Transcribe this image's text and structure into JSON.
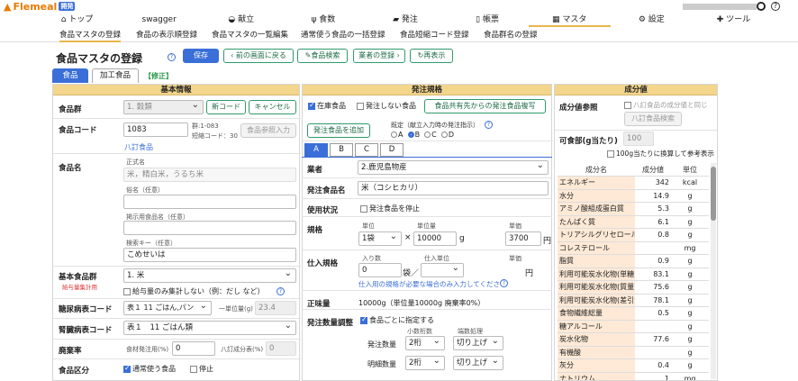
{
  "app": {
    "logo": "Flemeal",
    "badge": "開発"
  },
  "nav": [
    "トップ",
    "swagger",
    "献立",
    "食数",
    "発注",
    "帳票",
    "マスタ",
    "設定",
    "ツール"
  ],
  "nav_icons": [
    "home-icon",
    "",
    "rice-bowl-icon",
    "utensils-icon",
    "truck-icon",
    "document-icon",
    "table-icon",
    "gear-icon",
    "wrench-icon"
  ],
  "subnav": [
    "食品マスタの登録",
    "食品の表示順登録",
    "食品マスタの一覧編集",
    "通常使う食品の一括登録",
    "食品短縮コード登録",
    "食品群名の登録"
  ],
  "page": {
    "title": "食品マスタの登録",
    "help": "?"
  },
  "toolbar": {
    "save": "保存",
    "back": "前の画面に戻る",
    "search": "食品検索",
    "vendor": "業者の登録",
    "refresh": "再表示"
  },
  "tabs": {
    "food": "食品",
    "processed": "加工食品",
    "mode": "【修正】"
  },
  "basic": {
    "header": "基本情報",
    "group_label": "食品群",
    "group_value": "1. 穀類",
    "new_code": "新コード",
    "cancel": "キャンセル",
    "code_label": "食品コード",
    "code_value": "1083",
    "code_group": "群:1-083",
    "code_short": "短縮コード：30",
    "ref_input": "食品参照入力",
    "hattei": "八訂食品",
    "name_label": "食品名",
    "formal_label": "正式名",
    "formal_value": "米，精白米，うるち米",
    "common_label": "俗名（任意）",
    "common_value": "",
    "post_label": "掲示用食品名（任意）",
    "post_value": "",
    "search_label": "検索キー（任意）",
    "search_value": "こめせいは",
    "base_label": "基本食品群",
    "base_sub": "給与量集計用",
    "base_value": "1. 米",
    "base_check": "給与量のみ集計しない（例：だし など）",
    "diabetes_label": "糖尿病表コード",
    "diabetes_value": "表１ 11 ごはん,パン",
    "unit_label": "一単位量(g)",
    "unit_value": "23.4",
    "kidney_label": "腎臓病表コード",
    "kidney_value": "表１　11 ごはん類",
    "waste_label": "廃棄率",
    "waste_ratio_label": "食材発注用(%)",
    "waste_ratio_value": "0",
    "waste_h_label": "八訂成分表(%)",
    "waste_h_value": "0",
    "div_label": "食品区分",
    "div_normal": "通常使う食品",
    "div_stop": "停止"
  },
  "order": {
    "header": "発注規格",
    "stock": "在庫食品",
    "no_order": "発注しない食品",
    "copy": "食品共有先からの発注食品複写",
    "add": "発注食品を追加",
    "default_label": "既定（献立入力時の発注指示）",
    "options": [
      "A",
      "B",
      "C",
      "D"
    ],
    "selected": "B",
    "tabs": [
      "A",
      "B",
      "C",
      "D"
    ],
    "vendor_label": "業者",
    "vendor_value": "2.鹿児島物産",
    "name_label": "発注食品名",
    "name_value": "米（コシヒカリ）",
    "use_label": "使用状況",
    "use_check": "発注食品を停止",
    "spec_label": "規格",
    "unit_h": "単位",
    "unit_v": "1袋",
    "qty_h": "単位量",
    "qty_v": "10000",
    "qty_unit": "g",
    "price_h": "単価",
    "price_v": "3700",
    "price_unit": "円",
    "in_label": "仕入規格",
    "in_count_h": "入り数",
    "in_count_v": "0",
    "in_unit": "袋／",
    "in_unit_h": "仕入単位",
    "in_price_h": "単価",
    "in_price_unit": "円",
    "in_link": "仕入用の規格が必要な場合のみ入力してください",
    "net_label": "正味量",
    "net_value": "10000g（単位量10000g 廃棄率0%）",
    "adjust_label": "発注数量調整",
    "adjust_check": "食品ごとに指定する",
    "dec_h": "小数桁数",
    "round_h": "端数処理",
    "order_qty_label": "発注数量",
    "order_qty_dec": "2桁",
    "order_qty_round": "切り上げ",
    "detail_qty_label": "明細数量",
    "detail_qty_dec": "2桁",
    "detail_qty_round": "切り上げ"
  },
  "nutri": {
    "header": "成分値",
    "ref_label": "成分値参照",
    "ref_check": "八訂食品の成分値と同じ",
    "ref_btn": "八訂食品検索",
    "edible_label": "可食部(g当たり)",
    "edible_value": "100",
    "per100": "100g当たりに換算して参考表示",
    "cols": [
      "成分名",
      "成分値",
      "単位"
    ],
    "rows": [
      [
        "エネルギー",
        "342",
        "kcal"
      ],
      [
        "水分",
        "14.9",
        "g"
      ],
      [
        "アミノ酸組成蛋白質",
        "5.3",
        "g"
      ],
      [
        "たんぱく質",
        "6.1",
        "g"
      ],
      [
        "トリアシルグリセロール当量",
        "0.8",
        "g"
      ],
      [
        "コレステロール",
        "",
        "mg"
      ],
      [
        "脂質",
        "0.9",
        "g"
      ],
      [
        "利用可能炭水化物(単糖当量)",
        "83.1",
        "g"
      ],
      [
        "利用可能炭水化物(質量計)",
        "75.6",
        "g"
      ],
      [
        "利用可能炭水化物(差引法)",
        "78.1",
        "g"
      ],
      [
        "食物繊維総量",
        "0.5",
        "g"
      ],
      [
        "糖アルコール",
        "",
        "g"
      ],
      [
        "炭水化物",
        "77.6",
        "g"
      ],
      [
        "有機酸",
        "",
        "g"
      ],
      [
        "灰分",
        "0.4",
        "g"
      ],
      [
        "ナトリウム",
        "1",
        "mg"
      ]
    ]
  }
}
